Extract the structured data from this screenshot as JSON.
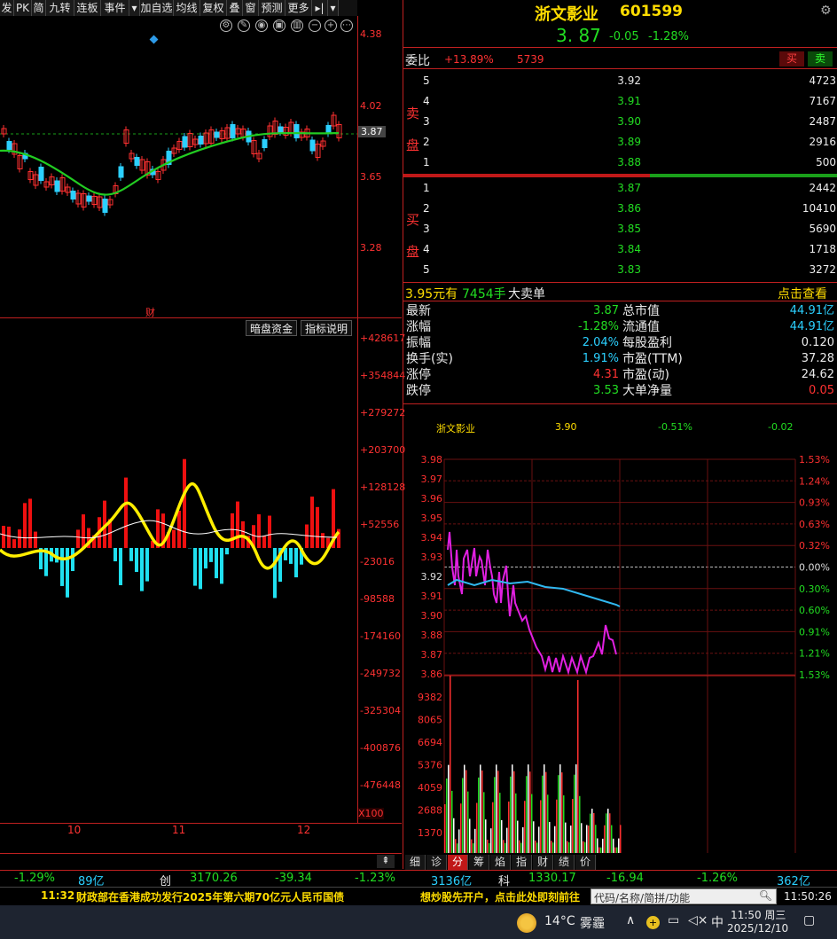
{
  "toolbar": {
    "buttons": [
      "发",
      "PK",
      "简",
      "九转",
      "连板",
      "事件",
      "▾",
      "加自选",
      "均线",
      "复权",
      "叠",
      "窗",
      "预测",
      "更多",
      "▸|",
      "▾"
    ]
  },
  "kline": {
    "price_axis": [
      "4.38",
      "4.02",
      "3.87",
      "3.65",
      "3.28"
    ],
    "finance_marker": "财"
  },
  "indicator": {
    "tab_hidden_capital": "暗盘资金",
    "tab_indicator_help": "指标说明",
    "axis": [
      "+428617",
      "+354844",
      "+279272",
      "+203700",
      "+128128",
      "+52556",
      "-23016",
      "-98588",
      "-174160",
      "-249732",
      "-325304",
      "-400876",
      "-476448"
    ],
    "axis_unit": "X100"
  },
  "date_axis": [
    "10",
    "11",
    "12"
  ],
  "quote": {
    "name": "浙文影业",
    "code": "601599",
    "price": "3. 87",
    "change": "-0.05",
    "change_pct": "-1.28%",
    "webi_label": "委比",
    "webi_value": "+13.89%",
    "webi_diff": "5739",
    "buy_button": "买",
    "sell_button": "卖",
    "sell_side_label": "卖盘",
    "buy_side_label": "买盘",
    "asks": [
      {
        "level": "5",
        "price": "3.92",
        "volume": "4723",
        "color": "white"
      },
      {
        "level": "4",
        "price": "3.91",
        "volume": "7167",
        "color": "green"
      },
      {
        "level": "3",
        "price": "3.90",
        "volume": "2487",
        "color": "green"
      },
      {
        "level": "2",
        "price": "3.89",
        "volume": "2916",
        "color": "green"
      },
      {
        "level": "1",
        "price": "3.88",
        "volume": "500",
        "color": "green"
      }
    ],
    "bids": [
      {
        "level": "1",
        "price": "3.87",
        "volume": "2442",
        "color": "green"
      },
      {
        "level": "2",
        "price": "3.86",
        "volume": "10410",
        "color": "green"
      },
      {
        "level": "3",
        "price": "3.85",
        "volume": "5690",
        "color": "green"
      },
      {
        "level": "4",
        "price": "3.84",
        "volume": "1718",
        "color": "green"
      },
      {
        "level": "5",
        "price": "3.83",
        "volume": "3272",
        "color": "green"
      }
    ],
    "big_order_price": "3.95元有",
    "big_order_vol": "7454手",
    "big_order_text": "大卖单",
    "big_order_link": "点击查看",
    "stats_left": [
      {
        "label": "最新",
        "value": "3.87",
        "color": "green"
      },
      {
        "label": "涨幅",
        "value": "-1.28%",
        "color": "green"
      },
      {
        "label": "振幅",
        "value": "2.04%",
        "color": "cyan"
      },
      {
        "label": "换手(实)",
        "value": "1.91%",
        "color": "cyan"
      },
      {
        "label": "涨停",
        "value": "4.31",
        "color": "red"
      },
      {
        "label": "跌停",
        "value": "3.53",
        "color": "green"
      }
    ],
    "stats_right": [
      {
        "label": "总市值",
        "value": "44.91亿",
        "color": "cyan"
      },
      {
        "label": "流通值",
        "value": "44.91亿",
        "color": "cyan"
      },
      {
        "label": "每股盈利",
        "value": "0.120",
        "color": "white"
      },
      {
        "label": "市盈(TTM)",
        "value": "37.28",
        "color": "white"
      },
      {
        "label": "市盈(动)",
        "value": "24.62",
        "color": "white"
      },
      {
        "label": "大单净量",
        "value": "0.05",
        "color": "red"
      }
    ]
  },
  "minute": {
    "name": "浙文影业",
    "price": "3.90",
    "pct": "-0.51%",
    "chg": "-0.02",
    "price_axis": [
      "3.98",
      "3.97",
      "3.96",
      "3.95",
      "3.94",
      "3.93",
      "3.92",
      "3.91",
      "3.90",
      "3.88",
      "3.87",
      "3.86"
    ],
    "pct_axis": [
      "1.53%",
      "1.24%",
      "0.93%",
      "0.63%",
      "0.32%",
      "0.00%",
      "0.30%",
      "0.60%",
      "0.91%",
      "1.21%",
      "1.53%"
    ],
    "vol_axis": [
      "9382",
      "8065",
      "6694",
      "5376",
      "4059",
      "2688",
      "1370"
    ]
  },
  "tabs": [
    "细",
    "诊",
    "分",
    "筹",
    "焰",
    "指",
    "财",
    "绩",
    "价"
  ],
  "market_bar": {
    "items": [
      "-1.29%",
      "89亿",
      "创",
      "3170.26",
      "-39.34",
      "-1.23%",
      "3136亿",
      "科",
      "1330.17",
      "-16.94",
      "-1.26%",
      "362亿"
    ]
  },
  "news": {
    "time": "11:32",
    "headline": "财政部在香港成功发行2025年第六期70亿元人民币国债",
    "ad": "想炒股先开户，点击此处即刻前往",
    "search_placeholder": "代码/名称/简拼/功能",
    "clock": "11:50:26"
  },
  "taskbar": {
    "weather_temp": "14°C",
    "weather_text": "雾霾",
    "ime": "中",
    "time": "11:50 周三",
    "date": "2025/12/10"
  }
}
